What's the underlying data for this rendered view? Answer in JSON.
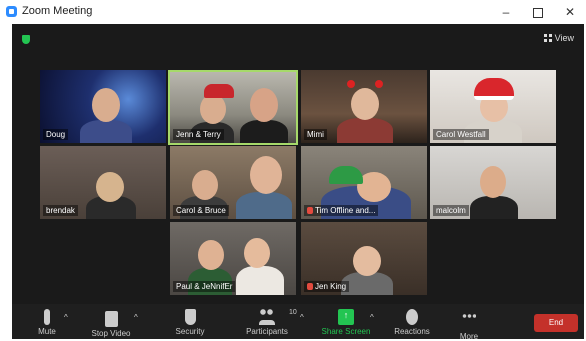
{
  "window": {
    "title": "Zoom Meeting",
    "minimize": "–",
    "close": "✕"
  },
  "meeting": {
    "view_label": "View",
    "tiles": [
      {
        "name": "Doug",
        "muted": false,
        "active": false
      },
      {
        "name": "Jenn & Terry",
        "muted": false,
        "active": true
      },
      {
        "name": "Mimi",
        "muted": false,
        "active": false
      },
      {
        "name": "Carol Westfall",
        "muted": false,
        "active": false
      },
      {
        "name": "brendak",
        "muted": false,
        "active": false
      },
      {
        "name": "Carol & Bruce",
        "muted": false,
        "active": false
      },
      {
        "name": "Tim Offline and...",
        "muted": true,
        "active": false
      },
      {
        "name": "malcolm",
        "muted": false,
        "active": false
      },
      {
        "name": "Paul & JeNnifEr",
        "muted": false,
        "active": false
      },
      {
        "name": "Jen King",
        "muted": true,
        "active": false
      }
    ]
  },
  "toolbar": {
    "mute": "Mute",
    "stop_video": "Stop Video",
    "security": "Security",
    "participants": "Participants",
    "participant_count": "10",
    "share_screen": "Share Screen",
    "reactions": "Reactions",
    "more": "More",
    "end": "End"
  },
  "colors": {
    "accent_green": "#23c552",
    "end_red": "#c4312a",
    "active_speaker": "#a6d96a"
  }
}
